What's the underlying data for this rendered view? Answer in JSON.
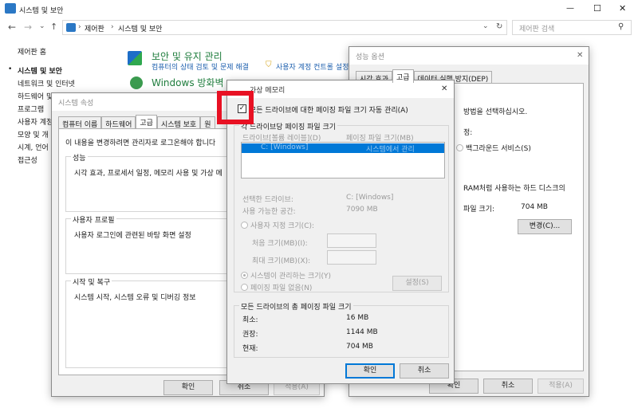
{
  "window": {
    "title": "시스템 및 보안",
    "controls": {
      "minimize": "—",
      "maximize": "☐",
      "close": "✕"
    }
  },
  "addressbar": {
    "path": [
      "제어판",
      "시스템 및 보안"
    ],
    "search_placeholder": "제어판 검색"
  },
  "sidebar": {
    "items": [
      "제어판 홈",
      "시스템 및 보안",
      "네트워크 및 인터넷",
      "하드웨어 및",
      "프로그램",
      "사용자 계정",
      "모양 및 개",
      "시계, 언어",
      "접근성"
    ]
  },
  "main": {
    "security_title": "보안 및 유지 관리",
    "security_link1": "컴퓨터의 상태 검토 및 문제 해결",
    "security_link2": "사용자 계정 컨트롤 설정",
    "firewall_title": "Windows 방화벽"
  },
  "sysprops": {
    "title": "시스템 속성",
    "tabs": [
      "컴퓨터 이름",
      "하드웨어",
      "고급",
      "시스템 보호",
      "원"
    ],
    "admin_note": "이 내용을 변경하려면 관리자로 로그온해야 합니다",
    "perf_label": "성능",
    "perf_desc": "시각 효과, 프로세서 일정, 메모리 사용 및 가상 메",
    "profile_label": "사용자 프로필",
    "profile_desc": "사용자 로그인에 관련된 바탕 화면 설정",
    "startup_label": "시작 및 복구",
    "startup_desc": "시스템 시작, 시스템 오류 및 디버깅 정보",
    "ok": "확인",
    "cancel": "취소",
    "apply": "적용(A)"
  },
  "perfopts": {
    "title": "성능 옵션",
    "tabs": [
      "시각 효과",
      "고급",
      "데이터 실행 방지(DEP)"
    ],
    "sched_desc": "방법을 선택하십시오.",
    "sched_label": "정:",
    "bg_services": "백그라운드 서비스(S)",
    "vm_desc": "RAM처럼 사용하는 하드 디스크의",
    "vm_size_label": "파일 크기:",
    "vm_size_value": "704 MB",
    "change": "변경(C)...",
    "ok": "확인",
    "cancel": "취소",
    "apply": "적용(A)"
  },
  "vmem": {
    "title": "가상 메모리",
    "auto_manage": "모든 드라이브에 대한 페이징 파일 크기 자동 관리(A)",
    "auto_checked": true,
    "per_drive_label": "각 드라이브당 페이징 파일 크기",
    "col_drive": "드라이브[볼륨 레이블](D)",
    "col_size": "페이징 파일 크기(MB)",
    "row_drive": "C:  [Windows]",
    "row_size": "시스템에서 관리",
    "selected_drive_label": "선택한 드라이브:",
    "selected_drive_value": "C:  [Windows]",
    "space_label": "사용 가능한 공간:",
    "space_value": "7090 MB",
    "custom_size": "사용자 지정 크기(C):",
    "initial_size": "처음 크기(MB)(I):",
    "max_size": "최대 크기(MB)(X):",
    "system_managed": "시스템이 관리하는 크기(Y)",
    "no_paging": "페이징 파일 없음(N)",
    "set": "설정(S)",
    "total_label": "모든 드라이브의 총 페이징 파일 크기",
    "min_label": "최소:",
    "min_value": "16 MB",
    "rec_label": "권장:",
    "rec_value": "1144 MB",
    "cur_label": "현재:",
    "cur_value": "704 MB",
    "ok": "확인",
    "cancel": "취소"
  },
  "highlight_color": "#e81123",
  "accent_color": "#0078d7"
}
